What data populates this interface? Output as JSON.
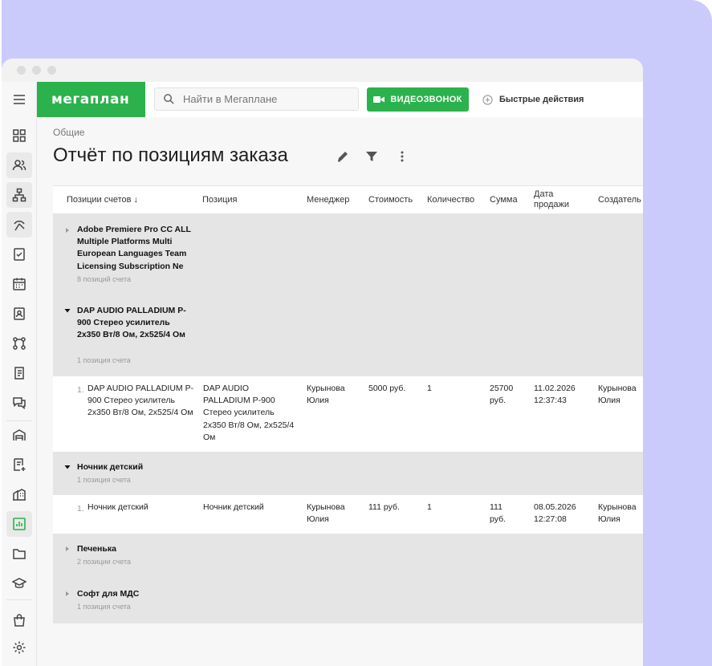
{
  "header": {
    "logo": "мегаплан",
    "search_placeholder": "Найти в Мегаплане",
    "video_button": "ВИДЕОЗВОНОК",
    "quick_actions": "Быстрые действия"
  },
  "page": {
    "breadcrumb": "Общие",
    "title": "Отчёт по позициям заказа"
  },
  "sidebar": {
    "icons": [
      "menu-icon",
      "dashboard-icon",
      "users-icon",
      "structure-icon",
      "deals-icon",
      "tasks-icon",
      "calendar-icon",
      "contacts-icon",
      "processes-icon",
      "invoices-icon",
      "chat-icon",
      "warehouse-icon",
      "documents-icon",
      "buildings-icon",
      "reports-icon",
      "files-icon",
      "education-icon",
      "shop-icon",
      "settings-icon"
    ]
  },
  "table": {
    "columns": [
      "Позиции счетов ↓",
      "Позиция",
      "Менеджер",
      "Стоимость",
      "Количество",
      "Сумма",
      "Дата продажи",
      "Создатель"
    ],
    "groups": [
      {
        "title": "Adobe Premiere Pro CC ALL Multiple Platforms Multi European Languages Team Licensing Subscription Ne",
        "subtitle": "8 позиций счета",
        "expanded": false,
        "rows": []
      },
      {
        "title": "DAP AUDIO PALLADIUM P-900 Стерео усилитель 2х350 Вт/8 Ом, 2х525/4 Ом",
        "subtitle": "1 позиция счета",
        "expanded": true,
        "rows": [
          {
            "num": "1.",
            "item": "DAP AUDIO PALLADIUM P-900 Стерео усилитель 2х350 Вт/8 Ом, 2х525/4 Ом",
            "position": "DAP AUDIO PALLADIUM P-900 Стерео усилитель 2х350 Вт/8 Ом, 2х525/4 Ом",
            "manager": "Курынова Юлия",
            "price": "5000 руб.",
            "qty": "1",
            "sum": "25700 руб.",
            "date": "11.02.2026 12:37:43",
            "creator": "Курынова Юлия"
          }
        ]
      },
      {
        "title": "Ночник детский",
        "subtitle": "1 позиция счета",
        "expanded": true,
        "rows": [
          {
            "num": "1.",
            "item": "Ночник детский",
            "position": "Ночник детский",
            "manager": "Курынова Юлия",
            "price": "111 руб.",
            "qty": "1",
            "sum": "111 руб.",
            "date": "08.05.2026 12:27:08",
            "creator": "Курынова Юлия"
          }
        ]
      },
      {
        "title": "Печенька",
        "subtitle": "2 позиции счета",
        "expanded": false,
        "rows": []
      },
      {
        "title": "Софт для МДС",
        "subtitle": "1 позиция счета",
        "expanded": false,
        "rows": []
      }
    ]
  },
  "colors": {
    "brand_green": "#2bb24c",
    "background_purple": "#cbcbfb",
    "group_row": "#e5e5e5"
  }
}
